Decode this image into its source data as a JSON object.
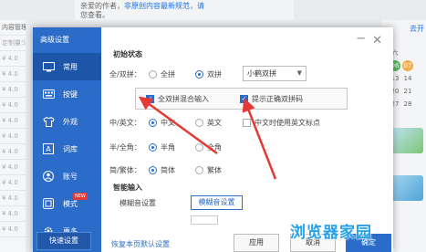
{
  "background": {
    "notice_line1": "亲爱的作者，",
    "notice_link": "非原创内容最新规范，请",
    "notice_line2": "您查看。",
    "left_rows": [
      "内容管理",
      "定制量少",
      "¥ 4.0",
      "¥ 4.0",
      "¥ 4.0",
      "¥ 4.0",
      "¥ 4.0",
      "¥ 4.0",
      "¥ 4.0",
      "¥ 4.0",
      "¥ 4.0",
      "¥ 4.0",
      "¥ 4.0",
      "¥ 4.0"
    ],
    "right_link": "去开",
    "calendar": [
      "六",
      "06",
      "07",
      "13",
      "14",
      "20",
      "21",
      "27",
      "28"
    ]
  },
  "dialog": {
    "sidebar_title": "高级设置",
    "nav": [
      {
        "label": "常用",
        "icon": "monitor-icon"
      },
      {
        "label": "按键",
        "icon": "keyboard-icon"
      },
      {
        "label": "外观",
        "icon": "shirt-icon"
      },
      {
        "label": "词库",
        "icon": "dictionary-icon"
      },
      {
        "label": "账号",
        "icon": "account-icon"
      },
      {
        "label": "模式",
        "icon": "mode-icon",
        "badge": "NEW"
      },
      {
        "label": "更多",
        "icon": "gear-icon"
      }
    ],
    "quick_setup": "快速设置",
    "initial_state": {
      "section": "初始状态",
      "pinyin_label": "全/双拼：",
      "quanpin": "全拼",
      "shuangpin": "双拼",
      "scheme": "小鹤双拼",
      "cb_mixed": "全双拼混合输入",
      "cb_hint": "提示正确双拼码",
      "cn_en_label": "中/英文：",
      "chinese": "中文",
      "english": "英文",
      "cb_punct": "中文时使用英文标点",
      "width_label": "半/全角：",
      "half": "半角",
      "full": "全角",
      "script_label": "简/繁体：",
      "simplified": "简体",
      "traditional": "繁体"
    },
    "smart_input": {
      "section": "智能输入",
      "fuzzy_label": "模糊音设置",
      "fuzzy_button": "模糊音设置"
    },
    "footer": {
      "restore": "恢复本页默认设置",
      "apply": "应用",
      "cancel": "取消",
      "ok": "确定"
    }
  },
  "watermark": "浏览器家园",
  "colors": {
    "accent": "#2b6cc9",
    "arrow": "#e53935"
  }
}
